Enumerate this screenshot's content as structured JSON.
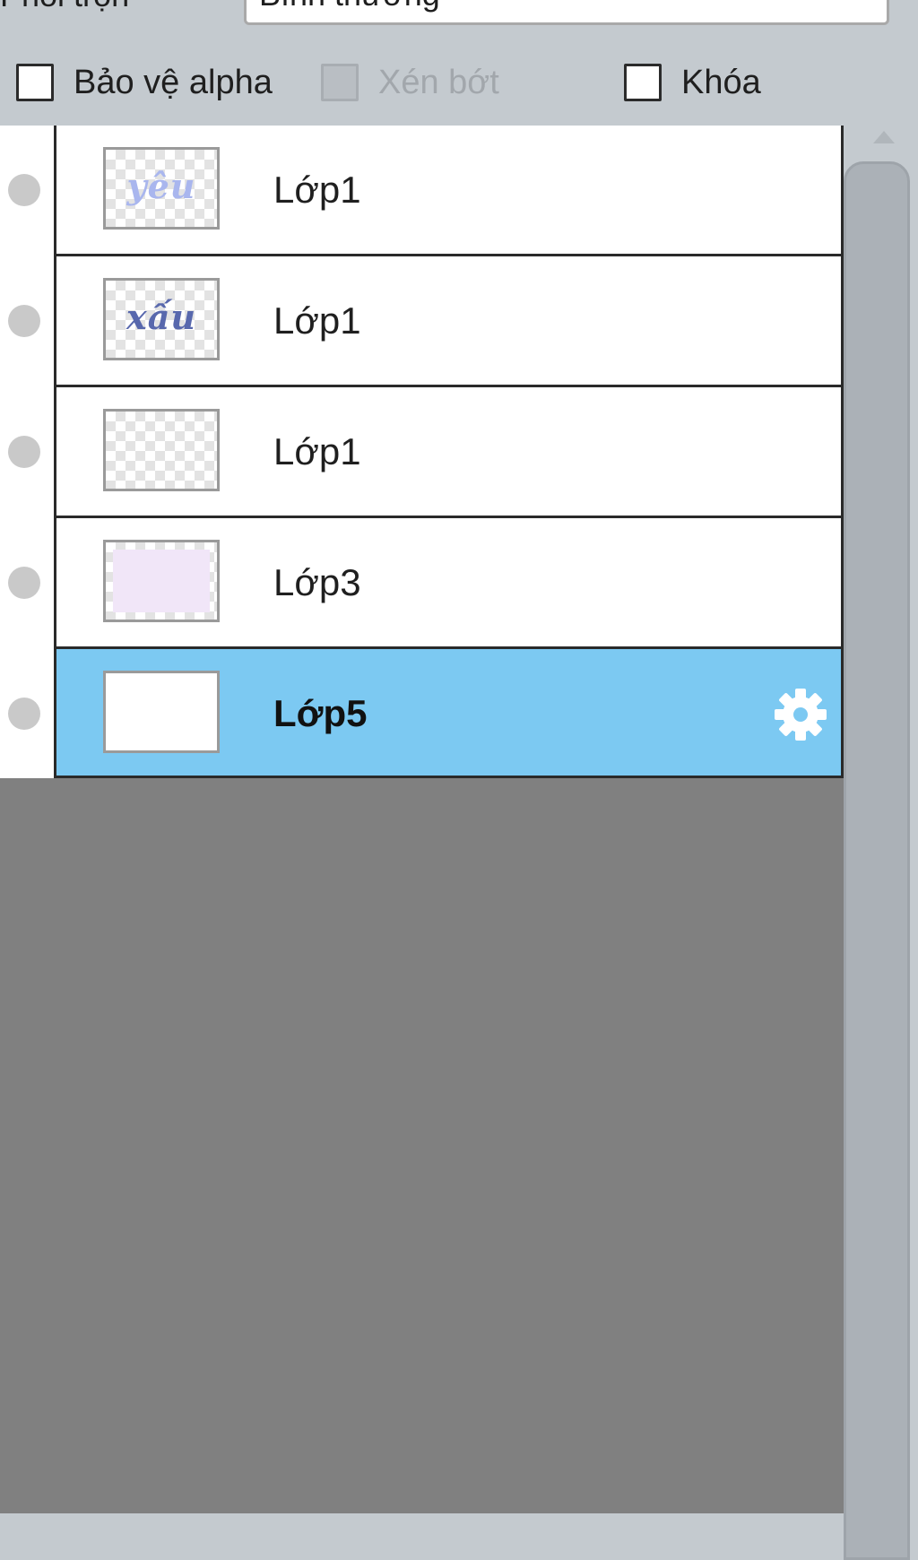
{
  "blend": {
    "label": "Phối trộn",
    "value": "Bình thường"
  },
  "options": [
    {
      "label": "Bảo vệ alpha",
      "checked": false,
      "enabled": true
    },
    {
      "label": "Xén bớt",
      "checked": false,
      "enabled": false
    },
    {
      "label": "Khóa",
      "checked": false,
      "enabled": true
    }
  ],
  "layers": [
    {
      "name": "Lớp1",
      "thumb_text": "yêu",
      "thumb_color": "#a9b6ee",
      "visible_icon": "visibility-dot-icon",
      "selected": false
    },
    {
      "name": "Lớp1",
      "thumb_text": "xấu",
      "thumb_color": "#5868ad",
      "visible_icon": "visibility-dot-icon",
      "selected": false
    },
    {
      "name": "Lớp1",
      "thumb_text": "",
      "thumb_color": "",
      "visible_icon": "visibility-dot-icon",
      "selected": false
    },
    {
      "name": "Lớp3",
      "thumb_text": "",
      "thumb_color": "#f1e6f8",
      "visible_icon": "visibility-dot-icon",
      "selected": false
    },
    {
      "name": "Lớp5",
      "thumb_text": "",
      "thumb_color": "#ffffff",
      "visible_icon": "visibility-dot-icon",
      "selected": true,
      "settings_icon": "gear-icon"
    }
  ],
  "colors": {
    "panel_bg": "#c4cacf",
    "list_empty_bg": "#808080",
    "selected_row": "#7cc9f2"
  }
}
